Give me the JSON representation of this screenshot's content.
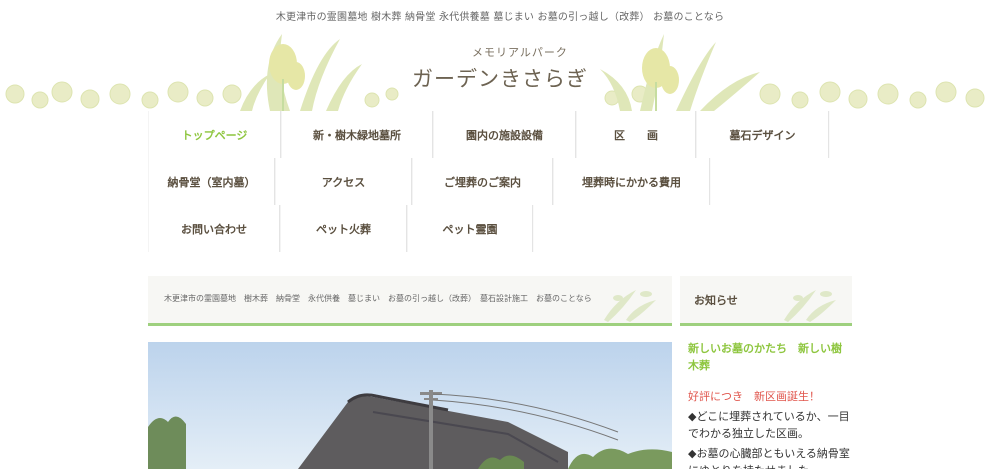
{
  "site": {
    "tagline": "木更津市の霊園墓地 樹木葬 納骨堂 永代供養墓 墓じまい お墓の引っ越し（改葬） お墓のことなら",
    "logo_sub": "メモリアルパーク",
    "logo_main": "ガーデンきさらぎ"
  },
  "nav": {
    "row1": [
      "トップページ",
      "新・樹木緑地墓所",
      "園内の施設設備",
      "区　　画",
      "墓石デザイン"
    ],
    "row2": [
      "納骨堂（室内墓）",
      "アクセス",
      "ご埋葬のご案内",
      "埋葬時にかかる費用"
    ],
    "row3": [
      "お問い合わせ",
      "ペット火葬",
      "ペット霊園"
    ],
    "active_index": 0
  },
  "breadcrumb": {
    "text": "木更津市の霊園墓地　樹木葬　納骨堂　永代供養　墓じまい　お墓の引っ越し（改葬）　墓石設計施工　お墓のことなら"
  },
  "sidebar": {
    "heading": "お知らせ",
    "post_title": "新しいお墓のかたち　新しい樹木葬",
    "post_highlight": "好評につき　新区画誕生！",
    "bullet1": "◆どこに埋葬されているか、一目でわかる独立した区画。",
    "bullet2": "◆お墓の心臓部ともいえる納骨室にゆとりを持たせました。"
  },
  "colors": {
    "accent_green": "#8ec63f",
    "divider_green": "#9ed07e",
    "highlight_red": "#e0554c",
    "text_brown": "#5b5040"
  }
}
